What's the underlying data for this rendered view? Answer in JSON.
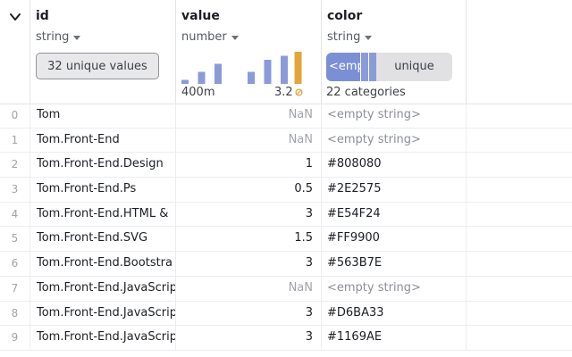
{
  "columns": {
    "id": {
      "name": "id",
      "type": "string",
      "summary_button": "32 unique values"
    },
    "value": {
      "name": "value",
      "type": "number",
      "hist_min": "400m",
      "hist_max": "3.2",
      "histogram": [
        {
          "value": 1,
          "color": "#8a9bd9"
        },
        {
          "value": 3,
          "color": "#8a9bd9"
        },
        {
          "value": 5,
          "color": "#8a9bd9"
        },
        {
          "value": 0,
          "color": "#8a9bd9"
        },
        {
          "value": 3,
          "color": "#8a9bd9"
        },
        {
          "value": 6,
          "color": "#8a9bd9"
        },
        {
          "value": 7,
          "color": "#8a9bd9"
        },
        {
          "value": 8,
          "color": "#e2a53a"
        }
      ]
    },
    "color": {
      "name": "color",
      "type": "string",
      "top_category": "<empty string>",
      "rest_label": "unique",
      "categories_count": "22 categories"
    }
  },
  "rows": [
    {
      "index": "0",
      "id": "Tom",
      "value": "NaN",
      "color": "<empty string>"
    },
    {
      "index": "1",
      "id": "Tom.Front-End",
      "value": "NaN",
      "color": "<empty string>"
    },
    {
      "index": "2",
      "id": "Tom.Front-End.Design",
      "value": "1",
      "color": "#808080"
    },
    {
      "index": "3",
      "id": "Tom.Front-End.Ps",
      "value": "0.5",
      "color": "#2E2575"
    },
    {
      "index": "4",
      "id": "Tom.Front-End.HTML &",
      "value": "3",
      "color": "#E54F24"
    },
    {
      "index": "5",
      "id": "Tom.Front-End.SVG",
      "value": "1.5",
      "color": "#FF9900"
    },
    {
      "index": "6",
      "id": "Tom.Front-End.Bootstra",
      "value": "3",
      "color": "#563B7E"
    },
    {
      "index": "7",
      "id": "Tom.Front-End.JavaScrip",
      "value": "NaN",
      "color": "<empty string>"
    },
    {
      "index": "8",
      "id": "Tom.Front-End.JavaScrip",
      "value": "3",
      "color": "#D6BA33"
    },
    {
      "index": "9",
      "id": "Tom.Front-End.JavaScrip",
      "value": "3",
      "color": "#1169AE"
    }
  ]
}
